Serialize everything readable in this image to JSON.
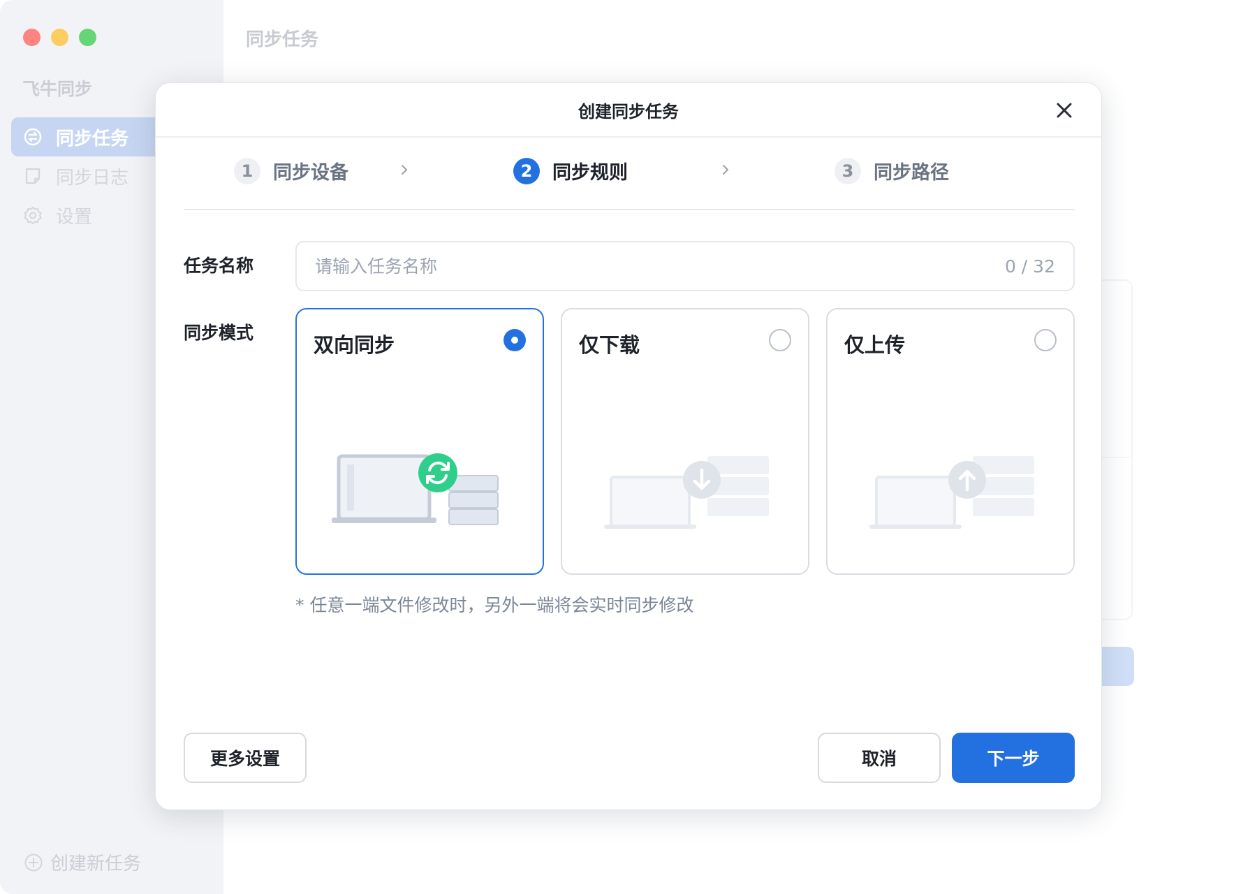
{
  "sidebar": {
    "app_name": "飞牛同步",
    "items": [
      {
        "label": "同步任务",
        "icon": "sync-tasks-icon",
        "active": true
      },
      {
        "label": "同步日志",
        "icon": "log-icon",
        "active": false
      },
      {
        "label": "设置",
        "icon": "gear-icon",
        "active": false
      }
    ],
    "create_label": "创建新任务"
  },
  "main": {
    "title": "同步任务"
  },
  "modal": {
    "title": "创建同步任务",
    "steps": [
      {
        "num": "1",
        "label": "同步设备",
        "active": false
      },
      {
        "num": "2",
        "label": "同步规则",
        "active": true
      },
      {
        "num": "3",
        "label": "同步路径",
        "active": false
      }
    ],
    "task_name": {
      "label": "任务名称",
      "placeholder": "请输入任务名称",
      "value": "",
      "counter": "0 / 32"
    },
    "sync_mode": {
      "label": "同步模式",
      "options": [
        {
          "label": "双向同步",
          "selected": true,
          "icon": "sync-arrows-icon"
        },
        {
          "label": "仅下载",
          "selected": false,
          "icon": "download-arrow-icon"
        },
        {
          "label": "仅上传",
          "selected": false,
          "icon": "upload-arrow-icon"
        }
      ],
      "hint": "* 任意一端文件修改时，另外一端将会实时同步修改"
    },
    "buttons": {
      "more_settings": "更多设置",
      "cancel": "取消",
      "next": "下一步"
    }
  },
  "colors": {
    "primary": "#2371e0",
    "sidebar_active": "#b3c9ee",
    "sync_green": "#2fcf8b",
    "close_red": "#fc5b57",
    "minimize_yellow": "#fdbc2e",
    "zoom_green": "#33c748"
  }
}
